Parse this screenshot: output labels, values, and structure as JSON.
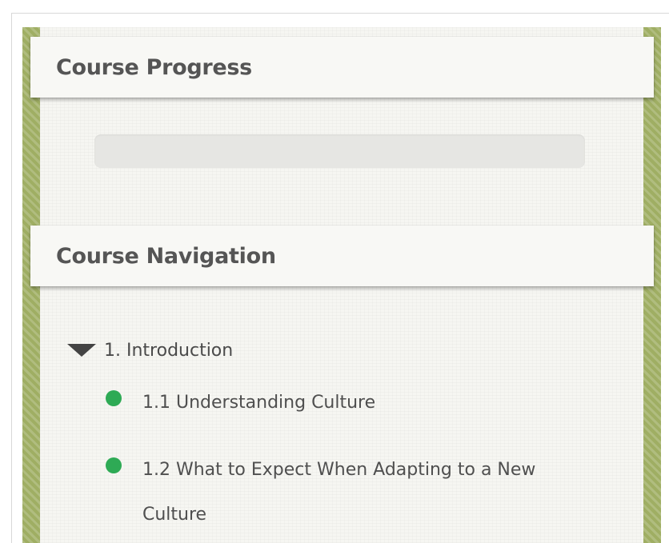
{
  "progress": {
    "title": "Course Progress",
    "percent_complete": 0
  },
  "navigation": {
    "title": "Course Navigation",
    "sections": [
      {
        "label": "1. Introduction",
        "expanded": true,
        "lessons": [
          {
            "label": "1.1 Understanding Culture",
            "status": "complete"
          },
          {
            "label": "1.2 What to Expect When Adapting to a New Culture",
            "status": "complete"
          }
        ]
      }
    ]
  },
  "colors": {
    "sidebar_accent": "#9fae63",
    "complete_dot": "#2eaa55",
    "heading_text": "#555555"
  },
  "icons": {
    "section_toggle": "triangle-down-icon",
    "lesson_status": "dot-icon"
  }
}
